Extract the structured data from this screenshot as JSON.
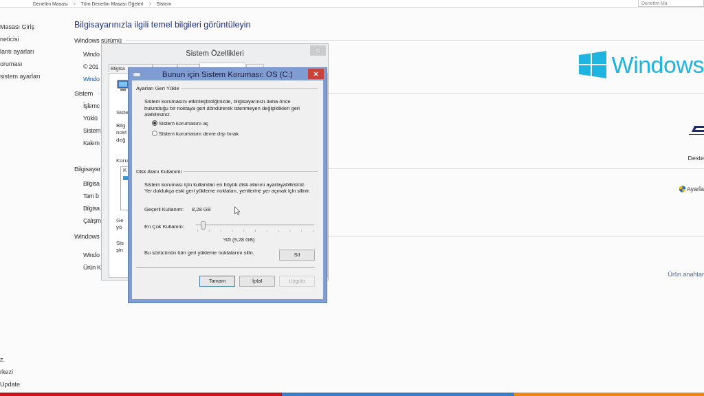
{
  "address_bar": {
    "crumbs": [
      "Denetim Masası",
      "Tüm Denetim Masası Öğeleri",
      "Sistem"
    ],
    "search": {
      "placeholder": "Denetim Ma"
    }
  },
  "sidebar": {
    "top_links": [
      "Masası Giriş",
      "neticisi",
      "lantı ayarları",
      "oruması",
      "sistem ayarları"
    ],
    "bottom_links": [
      "z.",
      "rkezi",
      "Update"
    ]
  },
  "main": {
    "heading": "Bilgisayarınızla ilgili temel bilgileri görüntüleyin",
    "sections": [
      {
        "title": "Windows sürümü",
        "rows": [
          {
            "kind": "text",
            "text": "Windo"
          },
          {
            "kind": "text",
            "text": "© 201"
          },
          {
            "kind": "link",
            "text": "Windo"
          }
        ],
        "side": {
          "kind": "logo",
          "text": "Windows"
        }
      },
      {
        "title": "Sistem",
        "rows": [
          {
            "kind": "text",
            "text": "İşlemc"
          },
          {
            "kind": "text",
            "text": "Yüklü"
          },
          {
            "kind": "text",
            "text": "Sistem"
          },
          {
            "kind": "text",
            "text": "Kalem"
          }
        ],
        "side": {
          "kind": "vendor",
          "text": "Deste"
        }
      },
      {
        "title": "Bilgisayar",
        "rows": [
          {
            "kind": "text",
            "text": "Bilgisa"
          },
          {
            "kind": "text",
            "text": "Tam b"
          },
          {
            "kind": "text",
            "text": "Bilgisa"
          },
          {
            "kind": "text",
            "text": "Çalışm"
          }
        ],
        "side": {
          "kind": "shield_link",
          "text": "Ayarla"
        }
      },
      {
        "title": "Windows",
        "rows": [
          {
            "kind": "text",
            "text": "Windo"
          },
          {
            "kind": "text",
            "text": "Ürün K"
          }
        ],
        "side": {
          "kind": "link",
          "text": "Ürün anahtar"
        }
      }
    ]
  },
  "back_window": {
    "title": "Sistem Özellikleri",
    "tabs": [
      {
        "label": "Bilgisa",
        "selected": false
      },
      {
        "selected": false
      },
      {
        "selected": false
      },
      {
        "selected": true
      },
      {
        "selected": false
      }
    ],
    "fragments": [
      {
        "kind": "icon"
      },
      {
        "kind": "text",
        "lines": [
          "Siste"
        ]
      },
      {
        "kind": "text",
        "lines": [
          "Bilg",
          "nokt",
          "değ"
        ]
      },
      {
        "kind": "text",
        "lines": [
          "Koru"
        ]
      },
      {
        "kind": "list",
        "text": "K"
      },
      {
        "kind": "text",
        "lines": [
          "Ge",
          "yö"
        ]
      },
      {
        "kind": "text",
        "lines": [
          "Sis",
          "şin"
        ]
      }
    ]
  },
  "dialog": {
    "title": "Bunun için Sistem Koruması: OS (C:)",
    "restore": {
      "legend": "Ayarları Geri Yükle",
      "text": "Sistem korumasını etkinleştirdiğinizde, bilgisayarınızı daha önce bulunduğu bir noktaya geri döndürerek istenmeyen değişiklikleri geri alabilirsiniz.",
      "options": [
        {
          "label": "Sistem korumasını aç",
          "selected": true
        },
        {
          "label": "Sistem korumasını devre dışı bırak",
          "selected": false
        }
      ]
    },
    "disk": {
      "legend": "Disk Alanı Kullanımı",
      "text": "Sistem koruması için kullanılan en büyük disk alanını ayarlayabilirsiniz. Yer doldukça eski geri yükleme noktaları, yenilerine yer açmak için silinir.",
      "current_label": "Geçerli Kullanım:",
      "current_value": "8,28 GB",
      "max_label": "En Çok Kullanım:",
      "slider": {
        "level": 0.04
      },
      "reading": "%5 (9,28 GB)",
      "delete_text": "Bu sürücünün tüm geri yükleme noktalarını silin.",
      "delete_button": "Sil"
    },
    "buttons": [
      {
        "label": "Tamam",
        "default": true,
        "disabled": false
      },
      {
        "label": "İptal",
        "default": false,
        "disabled": false
      },
      {
        "label": "Uygula",
        "default": false,
        "disabled": true
      }
    ]
  }
}
